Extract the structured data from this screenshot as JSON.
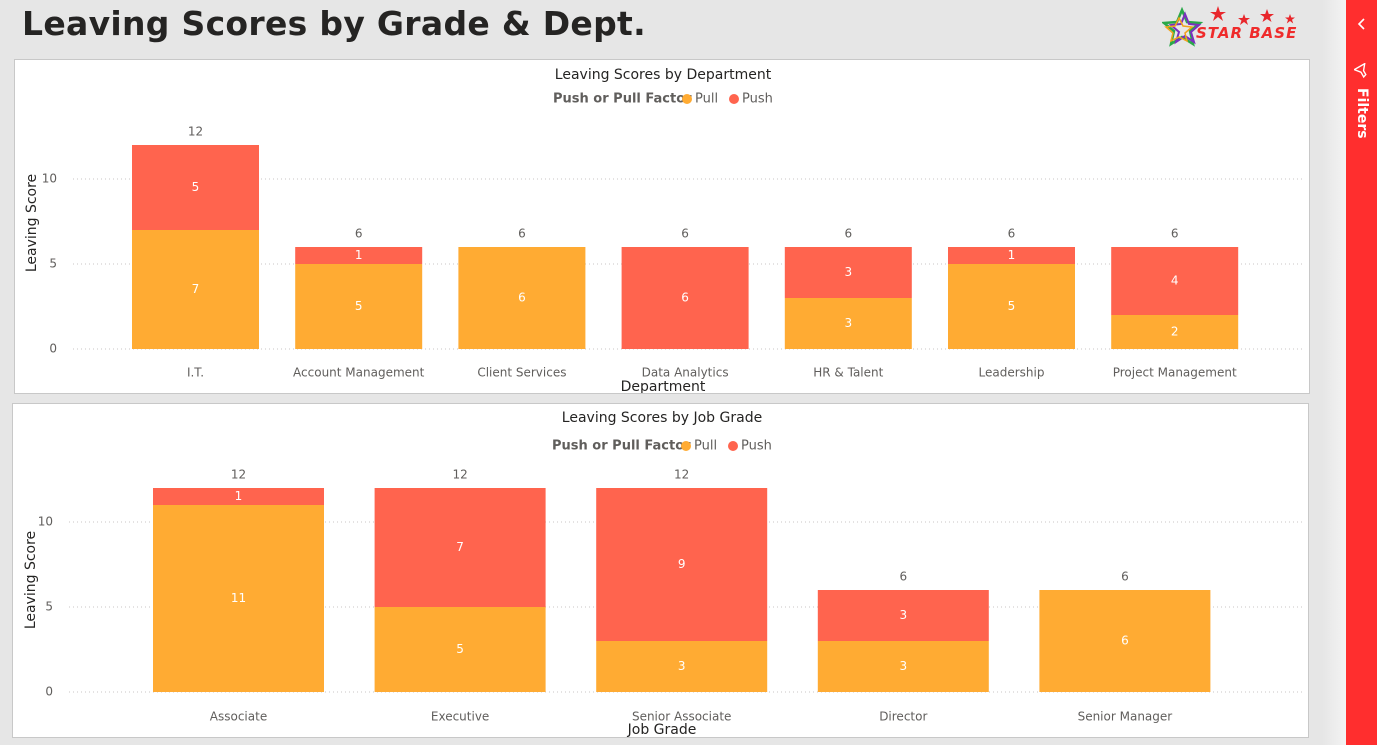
{
  "page": {
    "title": "Leaving Scores by Grade & Dept.",
    "logo_text": "STAR BASE",
    "filters_label": "Filters"
  },
  "colors": {
    "pull": "#FFAB33",
    "push": "#FF644E",
    "accent": "#FF2E2E"
  },
  "legend": {
    "title": "Push or Pull Factor",
    "pull": "Pull",
    "push": "Push"
  },
  "chart_data": [
    {
      "type": "bar",
      "stacked": true,
      "title": "Leaving Scores by Department",
      "xlabel": "Department",
      "ylabel": "Leaving Score",
      "ylim": [
        0,
        12
      ],
      "yticks": [
        0,
        5,
        10
      ],
      "grid": true,
      "legend_position": "top-center",
      "categories": [
        "I.T.",
        "Account Management",
        "Client Services",
        "Data Analytics",
        "HR & Talent",
        "Leadership",
        "Project Management"
      ],
      "series": [
        {
          "name": "Pull",
          "values": [
            7,
            5,
            6,
            0,
            3,
            5,
            2
          ]
        },
        {
          "name": "Push",
          "values": [
            5,
            1,
            0,
            6,
            3,
            1,
            4
          ]
        }
      ],
      "totals": [
        12,
        6,
        6,
        6,
        6,
        6,
        6
      ]
    },
    {
      "type": "bar",
      "stacked": true,
      "title": "Leaving Scores by Job Grade",
      "xlabel": "Job Grade",
      "ylabel": "Leaving Score",
      "ylim": [
        0,
        12
      ],
      "yticks": [
        0,
        5,
        10
      ],
      "grid": true,
      "legend_position": "top-center",
      "categories": [
        "Associate",
        "Executive",
        "Senior Associate",
        "Director",
        "Senior Manager"
      ],
      "series": [
        {
          "name": "Pull",
          "values": [
            11,
            5,
            3,
            3,
            6
          ]
        },
        {
          "name": "Push",
          "values": [
            1,
            7,
            9,
            3,
            0
          ]
        }
      ],
      "totals": [
        12,
        12,
        12,
        6,
        6
      ]
    }
  ]
}
